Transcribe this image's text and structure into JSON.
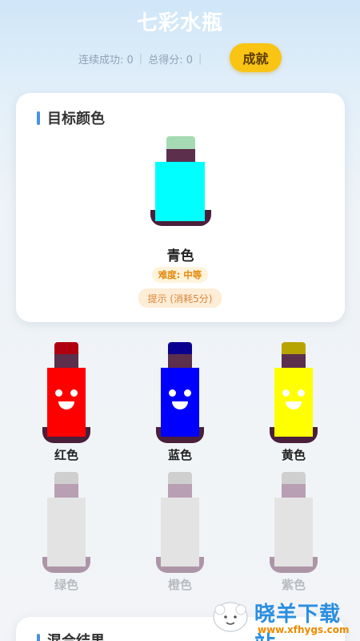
{
  "header": {
    "title": "七彩水瓶",
    "streak_label": "连续成功: 0",
    "score_label": "总得分: 0",
    "achievements_button": "成就"
  },
  "target": {
    "section_title": "目标颜色",
    "color_name": "青色",
    "difficulty": "难度: 中等",
    "hint_button": "提示 (消耗5分)",
    "colors": {
      "cap": "#a6dab4",
      "neck": "#5c2f4d",
      "liquid": "#00ffff",
      "base": "#4a1f3c"
    }
  },
  "bottles": [
    {
      "label": "红色",
      "state": "filled",
      "cap": "#b0000f",
      "liquid": "#ff0000"
    },
    {
      "label": "蓝色",
      "state": "filled",
      "cap": "#0a0090",
      "liquid": "#0000ff"
    },
    {
      "label": "黄色",
      "state": "filled",
      "cap": "#b8a400",
      "liquid": "#ffff00"
    },
    {
      "label": "绿色",
      "state": "empty"
    },
    {
      "label": "橙色",
      "state": "empty"
    },
    {
      "label": "紫色",
      "state": "empty"
    }
  ],
  "result": {
    "section_title": "混合结果"
  },
  "watermark": {
    "text": "晓羊下载站",
    "url": "www.xfhygs.com"
  }
}
